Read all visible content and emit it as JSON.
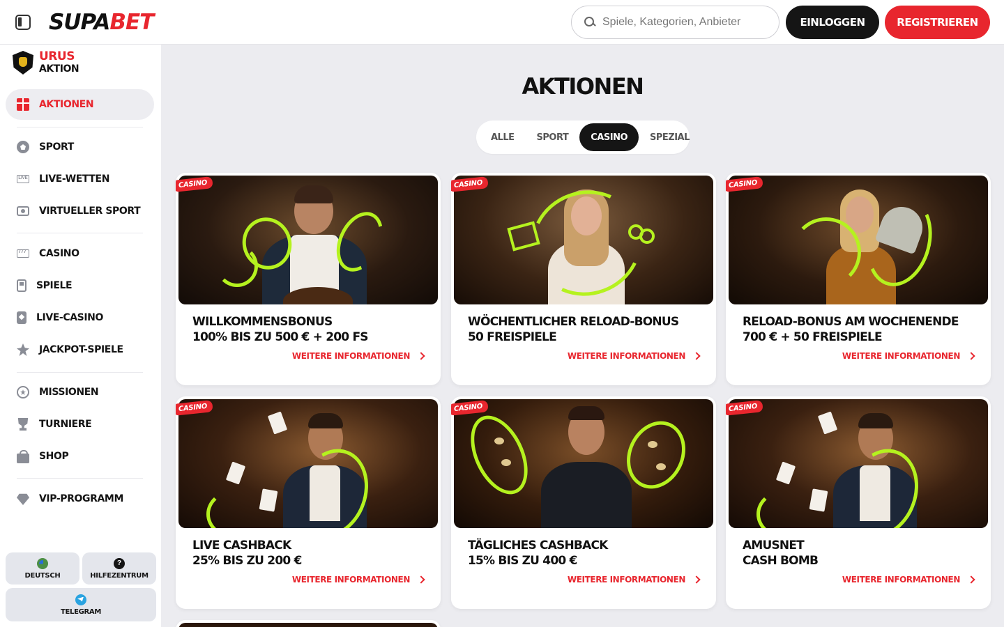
{
  "header": {
    "logo_part1": "SUPA",
    "logo_part2": "BET",
    "search_placeholder": "Spiele, Kategorien, Anbieter",
    "login_label": "EINLOGGEN",
    "register_label": "REGISTRIEREN"
  },
  "sidebar": {
    "promo": {
      "line1": "URUS",
      "line2": "AKTION"
    },
    "items": [
      {
        "label": "AKTIONEN",
        "icon": "gift-icon",
        "active": true
      },
      {
        "label": "SPORT",
        "icon": "football-icon"
      },
      {
        "label": "LIVE-WETTEN",
        "icon": "live-icon"
      },
      {
        "label": "VIRTUELLER SPORT",
        "icon": "virtual-sport-icon"
      },
      {
        "label": "CASINO",
        "icon": "slot-777-icon"
      },
      {
        "label": "SPIELE",
        "icon": "games-icon"
      },
      {
        "label": "LIVE-CASINO",
        "icon": "live-casino-icon"
      },
      {
        "label": "JACKPOT-SPIELE",
        "icon": "jackpot-icon"
      },
      {
        "label": "MISSIONEN",
        "icon": "missions-icon"
      },
      {
        "label": "TURNIERE",
        "icon": "trophy-icon"
      },
      {
        "label": "SHOP",
        "icon": "shop-icon"
      },
      {
        "label": "VIP-PROGRAMM",
        "icon": "diamond-icon"
      }
    ],
    "bottom": {
      "language": "DEUTSCH",
      "help": "HILFEZENTRUM",
      "telegram": "TELEGRAM"
    }
  },
  "main": {
    "title": "AKTIONEN",
    "tabs": [
      {
        "label": "ALLE"
      },
      {
        "label": "SPORT"
      },
      {
        "label": "CASINO",
        "active": true
      },
      {
        "label": "SPEZIAL"
      }
    ],
    "more_label": "WEITERE INFORMATIONEN",
    "cards": [
      {
        "tag": "CASINO",
        "line1": "WILLKOMMENSBONUS",
        "line2": "100% BIS ZU 500 € + 200 FS"
      },
      {
        "tag": "CASINO",
        "line1": "WÖCHENTLICHER RELOAD-BONUS",
        "line2": "50 FREISPIELE"
      },
      {
        "tag": "CASINO",
        "line1": "RELOAD-BONUS AM WOCHENENDE",
        "line2": "700 € + 50 FREISPIELE"
      },
      {
        "tag": "CASINO",
        "line1": "LIVE CASHBACK",
        "line2": "25% BIS ZU 200 €"
      },
      {
        "tag": "CASINO",
        "line1": "TÄGLICHES CASHBACK",
        "line2": "15% BIS ZU 400 €"
      },
      {
        "tag": "CASINO",
        "line1": "AMUSNET",
        "line2": "CASH BOMB"
      }
    ]
  },
  "colors": {
    "brand_red": "#e8262e",
    "accent_lime": "#b5f21f",
    "dark": "#151515"
  }
}
